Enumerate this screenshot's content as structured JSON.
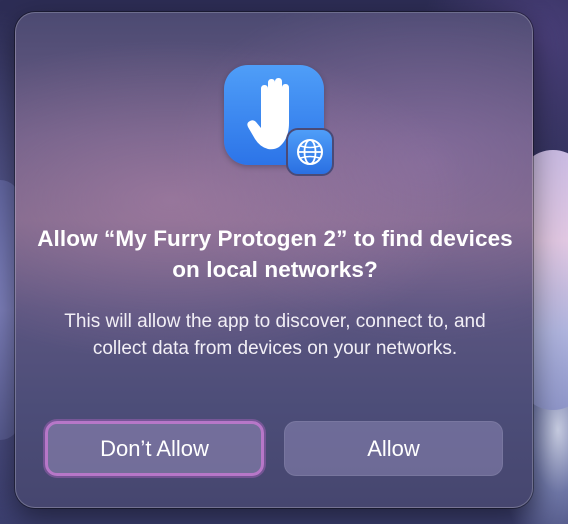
{
  "dialog": {
    "title": "Allow “My Furry Protogen 2” to find devices on local networks?",
    "message": "This will allow the app to discover, connect to, and collect data from devices on your networks.",
    "icon": "raised-hand-icon",
    "badge_icon": "globe-icon",
    "accent_color": "#2f7cf0"
  },
  "buttons": {
    "deny_label": "Don’t Allow",
    "allow_label": "Allow",
    "focus_color": "#b777c8"
  }
}
